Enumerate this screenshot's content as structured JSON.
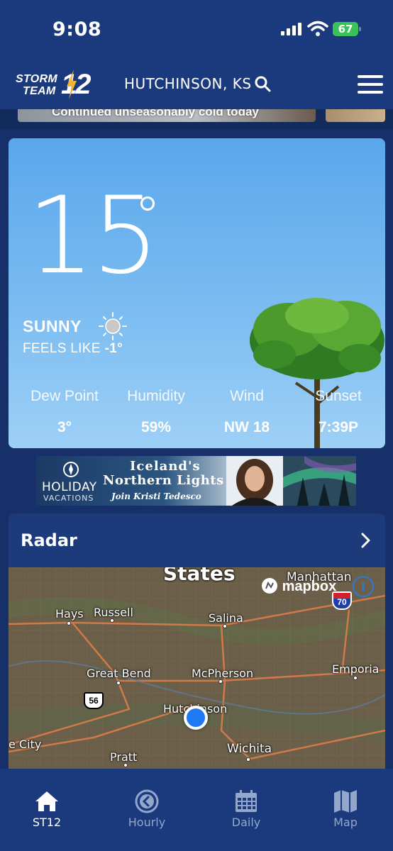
{
  "status_bar": {
    "time": "9:08",
    "battery": "67"
  },
  "header": {
    "logo": {
      "line1": "STORM",
      "line2": "TEAM",
      "number": "12"
    },
    "location": "HUTCHINSON, KS"
  },
  "news_peek": {
    "headline": "Continued unseasonably cold today"
  },
  "current": {
    "temperature": "15",
    "condition": "SUNNY",
    "feels_like_label": "FEELS LIKE",
    "feels_like_value": "-1°",
    "stats": [
      {
        "label": "Dew Point",
        "value": "3°"
      },
      {
        "label": "Humidity",
        "value": "59%"
      },
      {
        "label": "Wind",
        "value": "NW 18"
      },
      {
        "label": "Sunset",
        "value": "7:39P"
      }
    ]
  },
  "ad": {
    "brand_line1": "HOLIDAY",
    "brand_line2": "VACATIONS",
    "title_line1": "Iceland's",
    "title_line2": "Northern Lights",
    "subtitle": "Join Kristi Tedesco"
  },
  "radar": {
    "title": "Radar",
    "map_labels": {
      "states": "States",
      "manhattan": "Manhattan",
      "hays": "Hays",
      "russell": "Russell",
      "salina": "Salina",
      "great_bend": "Great Bend",
      "mcpherson": "McPherson",
      "emporia": "Emporia",
      "hutchinson": "Hutchinson",
      "city": "e City",
      "wichita": "Wichita",
      "pratt": "Pratt"
    },
    "attribution": "mapbox",
    "info": "i",
    "route_56": "56",
    "route_70": "70"
  },
  "tabbar": {
    "tabs": [
      {
        "label": "ST12",
        "icon": "home-icon",
        "active": true
      },
      {
        "label": "Hourly",
        "icon": "clock-back-icon",
        "active": false
      },
      {
        "label": "Daily",
        "icon": "calendar-icon",
        "active": false
      },
      {
        "label": "Map",
        "icon": "map-icon",
        "active": false
      }
    ]
  },
  "colors": {
    "background": "#17306a",
    "header": "#1a3a7d",
    "sky_top": "#5aa7ec",
    "sky_bottom": "#9ed0f6",
    "location_pin": "#1e7af2",
    "battery": "#39c258"
  }
}
